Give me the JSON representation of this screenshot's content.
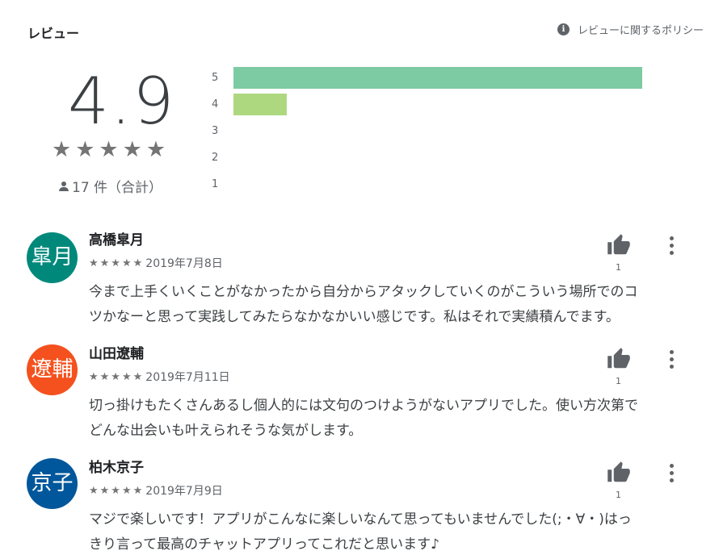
{
  "header": {
    "title": "レビュー",
    "policy_label": "レビューに関するポリシー"
  },
  "summary": {
    "score": "4.9",
    "stars": "★★★★★",
    "total": "17 件（合計）"
  },
  "histogram": {
    "rows": [
      {
        "label": "5",
        "fraction": 1.0,
        "color": "#7ccba2"
      },
      {
        "label": "4",
        "fraction": 0.13,
        "color": "#add87f"
      },
      {
        "label": "3",
        "fraction": 0,
        "color": "#f7d06b"
      },
      {
        "label": "2",
        "fraction": 0,
        "color": "#fbb26c"
      },
      {
        "label": "1",
        "fraction": 0,
        "color": "#f7856c"
      }
    ]
  },
  "reviews": [
    {
      "avatar": "皐月",
      "avatar_color": "#00897b",
      "name": "高橋皐月",
      "stars": "★★★★★",
      "date": "2019年7月8日",
      "likes": "1",
      "line1": "今まで上手くいくことがなかったから自分からアタックしていくのがこういう場所でのコ",
      "line2": "ツかなーと思って実践してみたらなかなかいい感じです。私はそれで実績積んでます。"
    },
    {
      "avatar": "遼輔",
      "avatar_color": "#f4511e",
      "name": "山田遼輔",
      "stars": "★★★★★",
      "date": "2019年7月11日",
      "likes": "1",
      "line1": "切っ掛けもたくさんあるし個人的には文句のつけようがないアプリでした。使い方次第で",
      "line2": "どんな出会いも叶えられそうな気がします。"
    },
    {
      "avatar": "京子",
      "avatar_color": "#01579b",
      "name": "柏木京子",
      "stars": "★★★★★",
      "date": "2019年7月9日",
      "likes": "1",
      "line1": "マジで楽しいです！アプリがこんなに楽しいなんて思ってもいませんでした(;・∀・)はっ",
      "line2": "きり言って最高のチャットアプリってこれだと思います♪"
    }
  ]
}
